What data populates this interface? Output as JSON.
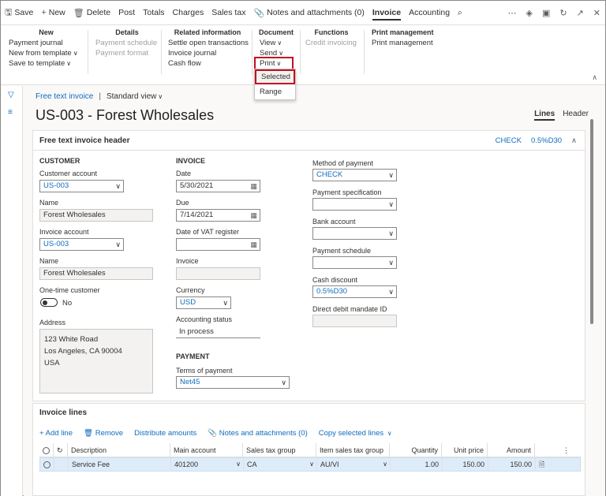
{
  "actionbar": {
    "save": "Save",
    "new": "New",
    "delete": "Delete",
    "post": "Post",
    "totals": "Totals",
    "charges": "Charges",
    "sales_tax": "Sales tax",
    "notes": "Notes and attachments (0)",
    "tab_invoice": "Invoice",
    "tab_accounting": "Accounting",
    "icons": [
      "save-icon",
      "plus-icon",
      "trash-icon",
      "paperclip-icon",
      "search-icon",
      "more-icon",
      "diamond-icon",
      "office-icon",
      "refresh-icon",
      "popout-icon",
      "close-icon"
    ]
  },
  "ribbon": {
    "new": {
      "title": "New",
      "items": [
        "Payment journal",
        "New from template",
        "Save to template"
      ]
    },
    "details": {
      "title": "Details",
      "items": [
        "Payment schedule",
        "Payment format"
      ]
    },
    "related": {
      "title": "Related information",
      "items": [
        "Settle open transactions",
        "Invoice journal",
        "Cash flow"
      ]
    },
    "document": {
      "title": "Document",
      "items": [
        "View",
        "Send",
        "Print"
      ]
    },
    "functions": {
      "title": "Functions",
      "items": [
        "Credit invoicing"
      ]
    },
    "print_mgmt": {
      "title": "Print management",
      "items": [
        "Print management"
      ]
    },
    "print_dropdown": [
      "Selected",
      "Range"
    ]
  },
  "page": {
    "breadcrumb": "Free text invoice",
    "view": "Standard view",
    "title": "US-003 - Forest Wholesales",
    "tabs": [
      "Lines",
      "Header"
    ]
  },
  "header": {
    "title": "Free text invoice header",
    "summary": [
      "CHECK",
      "0.5%D30"
    ],
    "customer": {
      "section": "CUSTOMER",
      "customer_account_label": "Customer account",
      "customer_account": "US-003",
      "name_label": "Name",
      "name": "Forest Wholesales",
      "invoice_account_label": "Invoice account",
      "invoice_account": "US-003",
      "name2_label": "Name",
      "name2": "Forest Wholesales",
      "onetime_label": "One-time customer",
      "onetime_value": "No",
      "address_label": "Address",
      "address": [
        "123 White Road",
        "Los Angeles, CA 90004",
        "USA"
      ]
    },
    "invoice": {
      "section": "INVOICE",
      "date_label": "Date",
      "date": "5/30/2021",
      "due_label": "Due",
      "due": "7/14/2021",
      "vat_label": "Date of VAT register",
      "vat": "",
      "invoice_label": "Invoice",
      "invoice": "",
      "currency_label": "Currency",
      "currency": "USD",
      "status_label": "Accounting status",
      "status": "In process"
    },
    "payment": {
      "section": "PAYMENT",
      "terms_label": "Terms of payment",
      "terms": "Net45"
    },
    "method": {
      "method_label": "Method of payment",
      "method": "CHECK",
      "spec_label": "Payment specification",
      "spec": "",
      "bank_label": "Bank account",
      "bank": "",
      "schedule_label": "Payment schedule",
      "schedule": "",
      "discount_label": "Cash discount",
      "discount": "0.5%D30",
      "mandate_label": "Direct debit mandate ID",
      "mandate": ""
    }
  },
  "lines": {
    "title": "Invoice lines",
    "toolbar": [
      "Add line",
      "Remove",
      "Distribute amounts",
      "Notes and attachments (0)",
      "Copy selected lines"
    ],
    "columns": [
      "Description",
      "Main account",
      "Sales tax group",
      "Item sales tax group",
      "Quantity",
      "Unit price",
      "Amount"
    ],
    "rows": [
      {
        "description": "Service Fee",
        "main_account": "401200",
        "sales_tax_group": "CA",
        "item_sales_tax_group": "AU/VI",
        "quantity": "1.00",
        "unit_price": "150.00",
        "amount": "150.00"
      }
    ]
  }
}
